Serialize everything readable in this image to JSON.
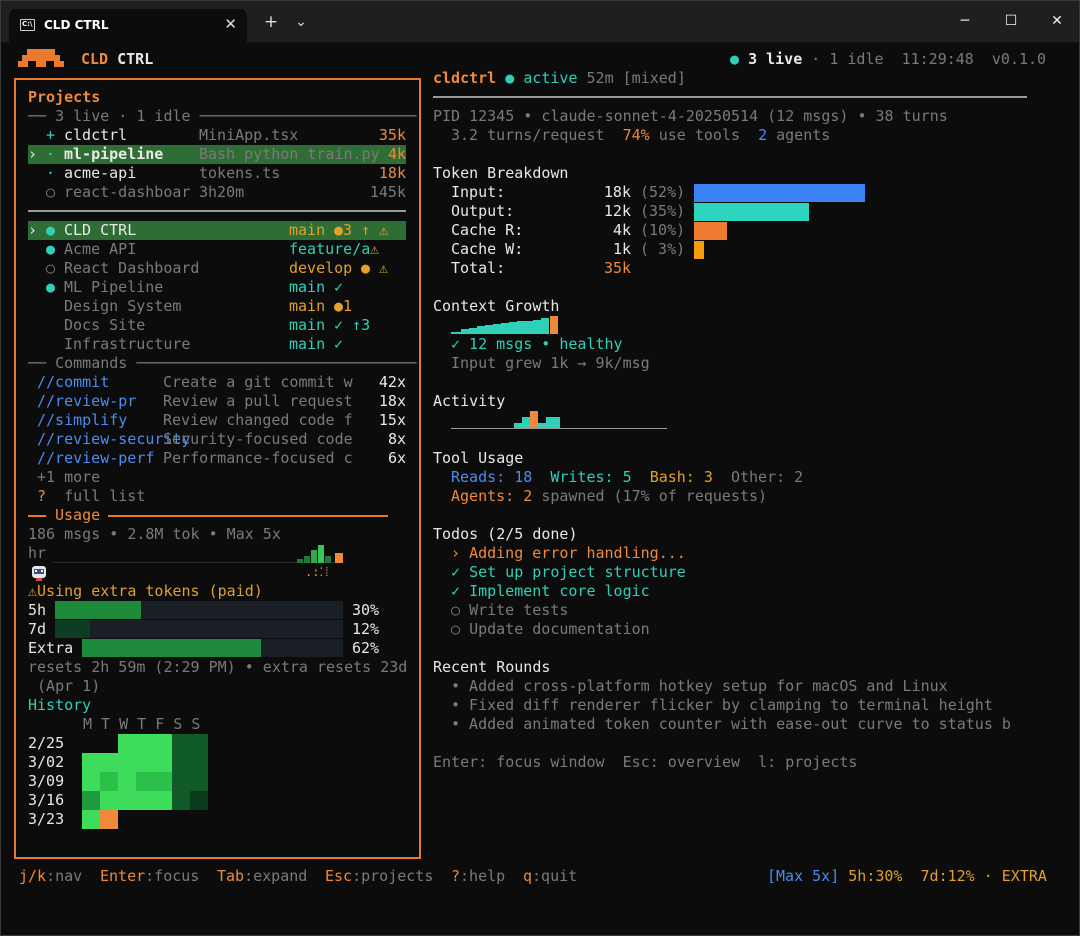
{
  "window": {
    "tab_title": "CLD CTRL",
    "tab_icon": "terminal-icon",
    "new_tab": "+",
    "dropdown": "⌄",
    "close_tab": "✕",
    "minimize": "─",
    "maximize": "☐",
    "close": "✕"
  },
  "header": {
    "app_name_1": "CLD",
    "app_name_2": "CTRL",
    "live_dot": "●",
    "live": "3 live",
    "idle": "· 1 idle",
    "clock": "11:29:48",
    "version": "v0.1.0"
  },
  "projects": {
    "title": "Projects",
    "summary": "── 3 live · 1 idle ────────────────────────",
    "sessions": [
      {
        "mark": " ",
        "icon": "+",
        "name": "cldctrl",
        "task": "MiniApp.tsx",
        "tokens": "35k"
      },
      {
        "mark": "›",
        "icon": "·",
        "name": "ml-pipeline",
        "task": "Bash python train.py",
        "tokens": "4k"
      },
      {
        "mark": " ",
        "icon": "·",
        "name": "acme-api",
        "task": "tokens.ts",
        "tokens": "18k"
      },
      {
        "mark": " ",
        "icon": "○",
        "name": "react-dashboar",
        "task": "3h20m",
        "tokens": "145k"
      }
    ],
    "repos": [
      {
        "mark": "›",
        "dot": "●",
        "name": "CLD CTRL",
        "branch": "main",
        "status": "●3 ↑ ⚠"
      },
      {
        "mark": " ",
        "dot": "●",
        "name": "Acme API",
        "branch": "feature/a",
        "status": "⚠"
      },
      {
        "mark": " ",
        "dot": "○",
        "name": "React Dashboard",
        "branch": "develop",
        "status": "● ⚠"
      },
      {
        "mark": " ",
        "dot": "●",
        "name": "ML Pipeline",
        "branch": "main",
        "status": "✓"
      },
      {
        "mark": " ",
        "dot": " ",
        "name": "Design System",
        "branch": "main",
        "status": "●1"
      },
      {
        "mark": " ",
        "dot": " ",
        "name": "Docs Site",
        "branch": "main",
        "status": "✓ ↑3"
      },
      {
        "mark": " ",
        "dot": " ",
        "name": "Infrastructure",
        "branch": "main",
        "status": "✓"
      }
    ],
    "commands_title": "── Commands ───────────────────────────────",
    "commands": [
      {
        "name": "//commit",
        "desc": "Create a git commit w",
        "count": "42x"
      },
      {
        "name": "//review-pr",
        "desc": "Review a pull request",
        "count": "18x"
      },
      {
        "name": "//simplify",
        "desc": "Review changed code f",
        "count": "15x"
      },
      {
        "name": "//review-security",
        "desc": "Security-focused code",
        "count": "8x"
      },
      {
        "name": "//review-perf",
        "desc": "Performance-focused c",
        "count": "6x"
      }
    ],
    "more": "+1 more",
    "full_list_key": "?",
    "full_list": "full list"
  },
  "usage": {
    "title": "Usage",
    "summary": "186 msgs • 2.8M tok • Max 5x",
    "hr": "hr",
    "mascot": "robot-icon",
    "extra_warning": "⚠Using extra tokens (paid)",
    "bars": [
      {
        "label": "5h",
        "value": 30,
        "pct": "30%"
      },
      {
        "label": "7d",
        "value": 12,
        "pct": "12%"
      },
      {
        "label": "Extra",
        "value": 62,
        "pct": "62%"
      }
    ],
    "resets": "resets 2h 59m (2:29 PM) • extra resets 23d",
    "resets_2": " (Apr 1)"
  },
  "history": {
    "title": "History",
    "days": "M T W T F S S",
    "weeks": [
      "2/25",
      "3/02",
      "3/09",
      "3/16",
      "3/23"
    ]
  },
  "detail": {
    "name": "cldctrl",
    "dot": "●",
    "status": "active",
    "duration": "52m",
    "mode": "[mixed]",
    "pid_line": "PID 12345 • claude-sonnet-4-20250514 (12 msgs) • 38 turns",
    "turns_per_req": "3.2 turns/request",
    "use_tools_pct": "74%",
    "use_tools": "use tools",
    "agents_n": "2",
    "agents": "agents",
    "token_title": "Token Breakdown",
    "tokens": [
      {
        "label": "Input:",
        "value": "18k",
        "pct": "(52%)",
        "fraction": 52,
        "color": "#3b82f6"
      },
      {
        "label": "Output:",
        "value": "12k",
        "pct": "(35%)",
        "fraction": 35,
        "color": "#2dd4bf"
      },
      {
        "label": "Cache R:",
        "value": "4k",
        "pct": "(10%)",
        "fraction": 10,
        "color": "#f07a30"
      },
      {
        "label": "Cache W:",
        "value": "1k",
        "pct": "( 3%)",
        "fraction": 3,
        "color": "#f59e0b"
      }
    ],
    "total_label": "Total:",
    "total_value": "35k",
    "context_title": "Context Growth",
    "context_status": "✓ 12 msgs • healthy",
    "context_grew": "Input grew 1k → 9k/msg",
    "activity_title": "Activity",
    "tool_title": "Tool Usage",
    "reads_label": "Reads:",
    "reads": "18",
    "writes_label": "Writes:",
    "writes": "5",
    "bash_label": "Bash:",
    "bash": "3",
    "other": "Other: 2",
    "agents_label": "Agents:",
    "agents_count": "2",
    "agents_spawned": "spawned (17% of requests)",
    "todos_title": "Todos (2/5 done)",
    "todos": [
      {
        "mark": "›",
        "text": "Adding error handling...",
        "state": "active"
      },
      {
        "mark": "✓",
        "text": "Set up project structure",
        "state": "done"
      },
      {
        "mark": "✓",
        "text": "Implement core logic",
        "state": "done"
      },
      {
        "mark": "○",
        "text": "Write tests",
        "state": "todo"
      },
      {
        "mark": "○",
        "text": "Update documentation",
        "state": "todo"
      }
    ],
    "rounds_title": "Recent Rounds",
    "rounds": [
      "• Added cross-platform hotkey setup for macOS and Linux",
      "• Fixed diff renderer flicker by clamping to terminal height",
      "• Added animated token counter with ease-out curve to status b"
    ],
    "hint": "Enter: focus window  Esc: overview  l: projects"
  },
  "footer": {
    "keys": [
      {
        "key": "j/k",
        "label": ":nav"
      },
      {
        "key": "Enter",
        "label": ":focus"
      },
      {
        "key": "Tab",
        "label": ":expand"
      },
      {
        "key": "Esc",
        "label": ":projects"
      },
      {
        "key": "?",
        "label": ":help"
      },
      {
        "key": "q",
        "label": ":quit"
      }
    ],
    "plan": "[Max 5x]",
    "h5": "5h:30%",
    "d7": "7d:12%",
    "extra": "· EXTRA"
  },
  "colors": {
    "accent": "#f08a3a",
    "teal": "#2fd0b8",
    "blue": "#4a8cf0",
    "highlight": "#2e6e34"
  }
}
